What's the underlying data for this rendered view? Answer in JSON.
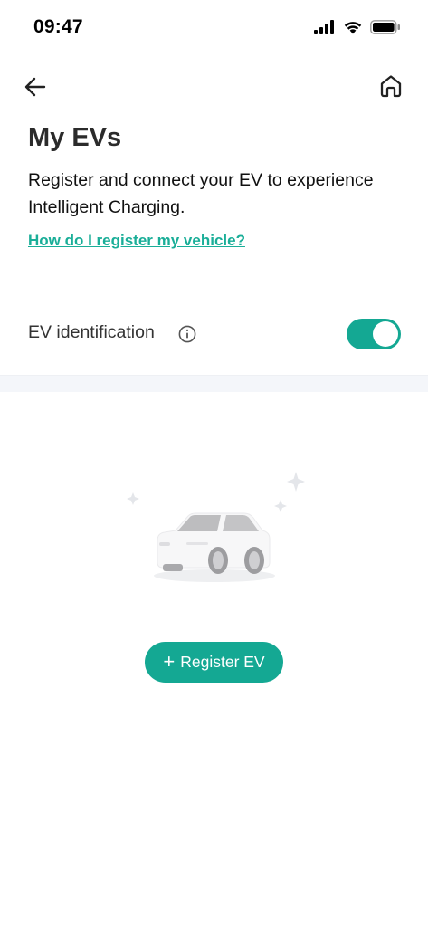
{
  "status_bar": {
    "time": "09:47"
  },
  "header": {
    "back_icon": "arrow-left-icon",
    "home_icon": "home-icon"
  },
  "page": {
    "title": "My EVs",
    "description": "Register and connect your EV to experience Intelligent Charging.",
    "help_link": "How do I register my vehicle?"
  },
  "ev_identification": {
    "label": "EV identification",
    "info_icon": "info-icon",
    "enabled": true
  },
  "empty_state": {
    "illustration": "car-sparkles-illustration",
    "register_button_plus": "+",
    "register_button_label": "Register EV"
  },
  "colors": {
    "accent": "#14a893",
    "link": "#1aae98",
    "band": "#f4f6fa"
  }
}
